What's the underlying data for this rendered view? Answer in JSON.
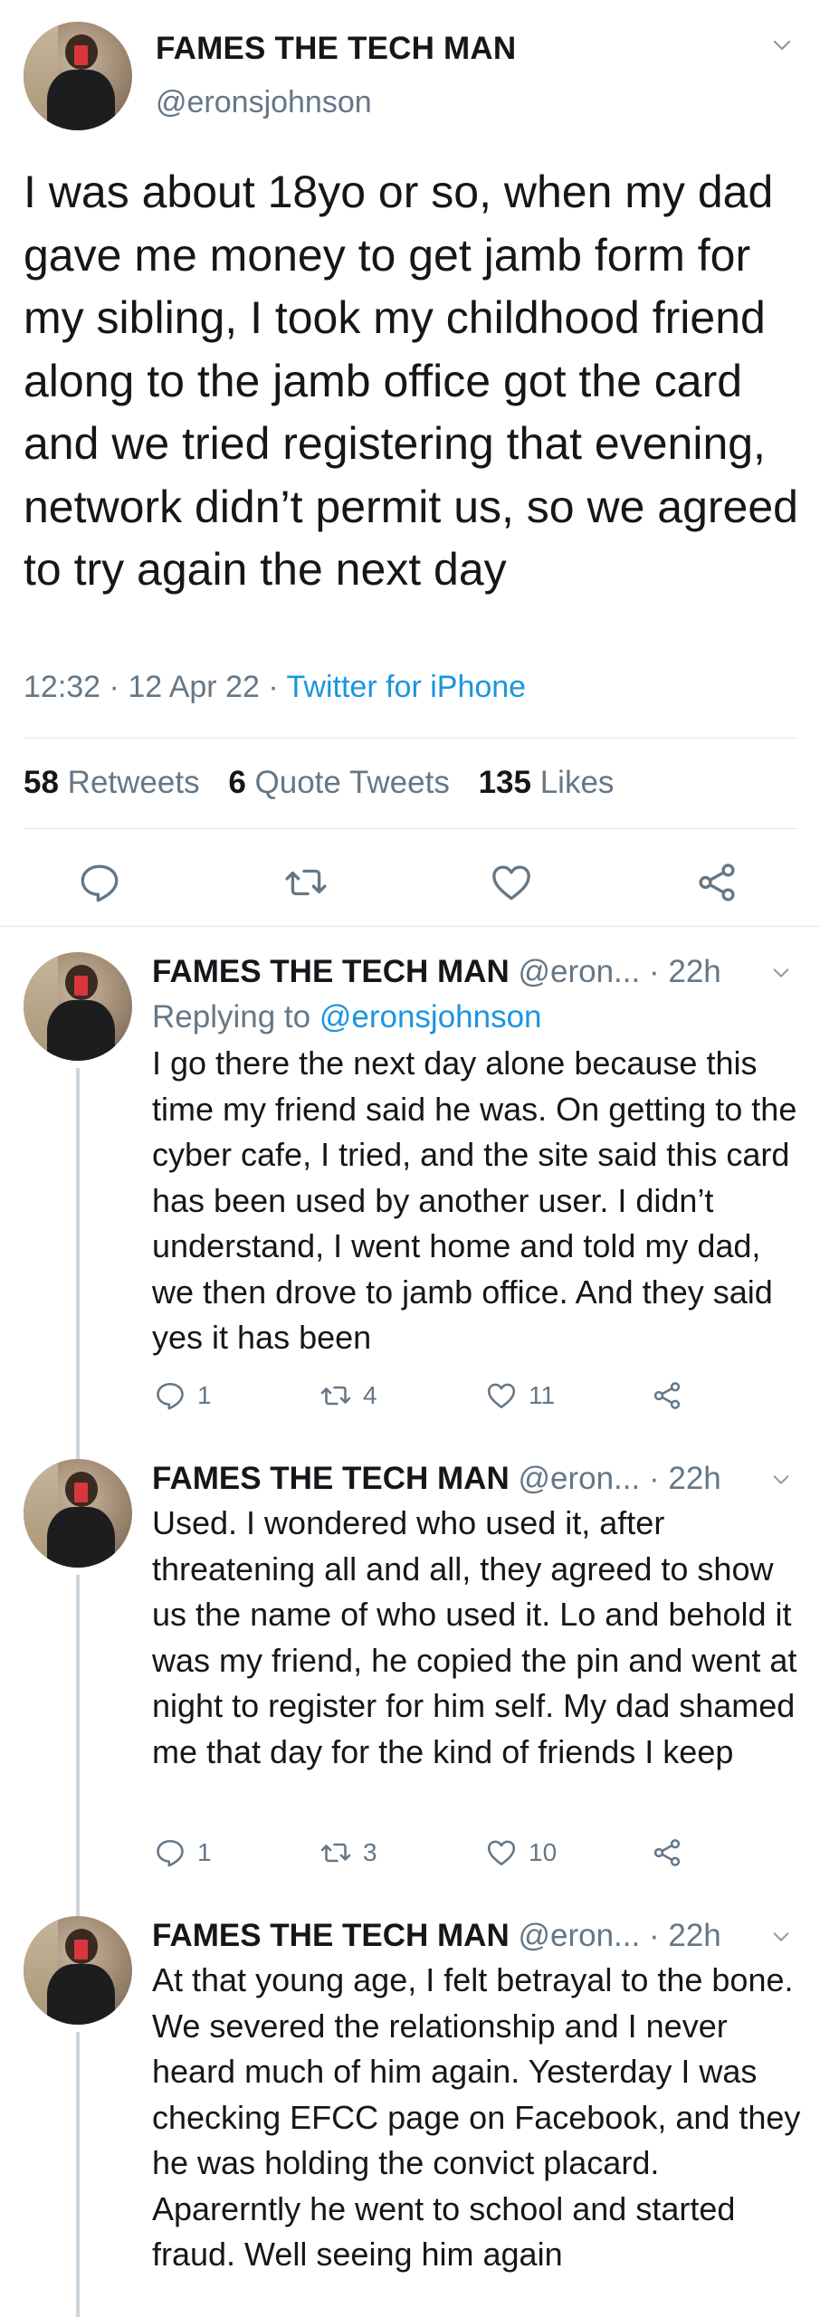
{
  "main_tweet": {
    "author_name": "FAMES THE TECH MAN",
    "author_handle": "@eronsjohnson",
    "text": "I was about 18yo or so, when my dad gave me money to get jamb form for my sibling, I took my childhood friend along to the jamb office got the card and we tried registering that evening, network didn’t permit us, so we agreed  to try again the next day",
    "time": "12:32",
    "date": "12 Apr 22",
    "source": "Twitter for iPhone",
    "separator": "·",
    "stats": {
      "retweets_count": "58",
      "retweets_label": "Retweets",
      "quotes_count": "6",
      "quotes_label": "Quote Tweets",
      "likes_count": "135",
      "likes_label": "Likes"
    },
    "actions": [
      "reply-icon",
      "retweet-icon",
      "like-icon",
      "share-icon"
    ]
  },
  "replies": [
    {
      "author_name": "FAMES THE TECH MAN",
      "author_handle": "@eron...",
      "age": "· 22h",
      "replying_prefix": "Replying to",
      "replying_to": "@eronsjohnson",
      "text": "I go there the next day alone because this time my friend said he was. On getting to the cyber cafe, I tried, and the site said this card has been used by another user. I didn’t understand, I went home and told my dad, we then drove to jamb office. And they said yes it has been",
      "reply_count": "1",
      "retweet_count": "4",
      "like_count": "11"
    },
    {
      "author_name": "FAMES THE TECH MAN",
      "author_handle": "@eron...",
      "age": "· 22h",
      "text": "Used. I wondered who used it, after threatening all and all, they agreed to show us the name of who used it. Lo and behold it was my friend, he copied the pin and went at night to register for him self. My dad shamed me that day for the kind of friends I keep",
      "reply_count": "1",
      "retweet_count": "3",
      "like_count": "10"
    },
    {
      "author_name": "FAMES THE TECH MAN",
      "author_handle": "@eron...",
      "age": "· 22h",
      "text": "At that young age, I felt betrayal to the bone. We severed the relationship and I never heard much of him again. Yesterday I was checking EFCC page on Facebook, and they he was holding the convict placard. Aparerntly he went to school and started fraud. Well seeing him again"
    }
  ],
  "colors": {
    "text_primary": "#14171a",
    "text_secondary": "#657786",
    "link": "#1b95e0",
    "divider": "#e1e8ed",
    "thread_line": "#ccd6dd"
  }
}
